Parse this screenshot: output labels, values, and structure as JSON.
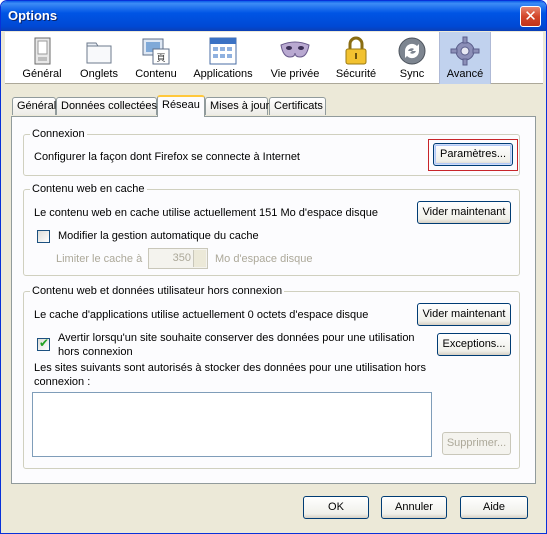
{
  "window": {
    "title": "Options",
    "close_glyph": "✕"
  },
  "panes": [
    {
      "label": "Général",
      "icon": "general-icon"
    },
    {
      "label": "Onglets",
      "icon": "tabs-icon"
    },
    {
      "label": "Contenu",
      "icon": "content-icon"
    },
    {
      "label": "Applications",
      "icon": "applications-icon"
    },
    {
      "label": "Vie privée",
      "icon": "privacy-mask-icon"
    },
    {
      "label": "Sécurité",
      "icon": "security-lock-icon"
    },
    {
      "label": "Sync",
      "icon": "sync-icon"
    },
    {
      "label": "Avancé",
      "icon": "advanced-gear-icon",
      "selected": true
    }
  ],
  "tabs": [
    {
      "label": "Général"
    },
    {
      "label": "Données collectées"
    },
    {
      "label": "Réseau",
      "active": true
    },
    {
      "label": "Mises à jour"
    },
    {
      "label": "Certificats"
    }
  ],
  "connection": {
    "legend": "Connexion",
    "description": "Configurer la façon dont Firefox se connecte à Internet",
    "settings_button": "Paramètres..."
  },
  "cache": {
    "legend": "Contenu web en cache",
    "usage": "Le contenu web en cache utilise actuellement 151 Mo d'espace disque",
    "clear_button": "Vider maintenant",
    "override_checkbox": "Modifier la gestion automatique du cache",
    "override_checked": false,
    "limit_label": "Limiter le cache à",
    "limit_value": "350",
    "limit_unit": "Mo d'espace disque"
  },
  "offline": {
    "legend": "Contenu web et données utilisateur hors connexion",
    "usage": "Le cache d'applications utilise actuellement 0 octets d'espace disque",
    "clear_button": "Vider maintenant",
    "warn_checkbox_line1": "Avertir lorsqu'un site souhaite conserver des données pour une utilisation",
    "warn_checkbox_line2": "hors connexion",
    "warn_checked": true,
    "exceptions_button": "Exceptions...",
    "sites_label_line1": "Les sites suivants sont autorisés à stocker des données pour une utilisation hors",
    "sites_label_line2": "connexion :",
    "remove_button": "Supprimer..."
  },
  "footer": {
    "ok": "OK",
    "cancel": "Annuler",
    "help": "Aide"
  },
  "colors": {
    "titlebar": "#0055e5",
    "dialog_bg": "#ece9d8",
    "highlight": "#c8252a"
  }
}
